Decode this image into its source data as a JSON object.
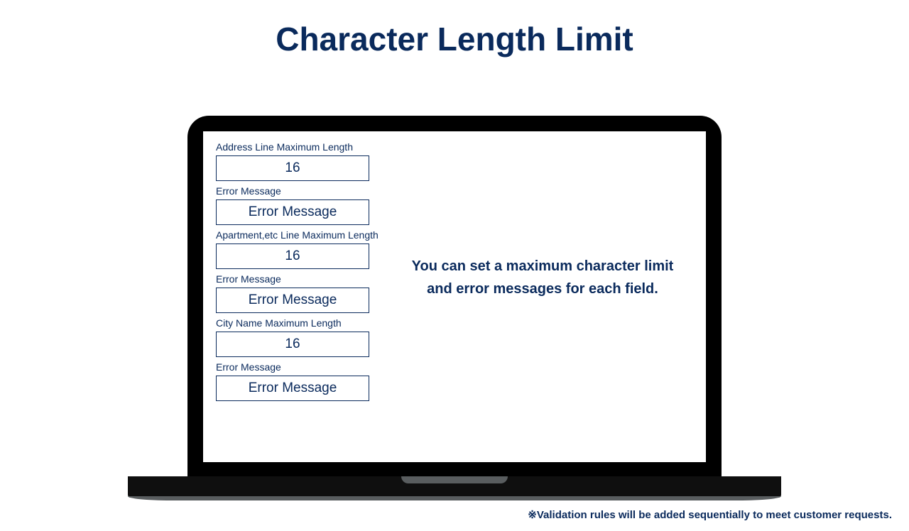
{
  "title": "Character Length Limit",
  "form": {
    "address": {
      "label": "Address Line Maximum Length",
      "value": "16",
      "error_label": "Error Message",
      "error_value": "Error Message"
    },
    "apartment": {
      "label": "Apartment,etc Line Maximum Length",
      "value": "16",
      "error_label": "Error Message",
      "error_value": "Error Message"
    },
    "city": {
      "label": "City Name Maximum Length",
      "value": "16",
      "error_label": "Error Message",
      "error_value": "Error Message"
    }
  },
  "description": {
    "line1": "You can set a maximum character limit",
    "line2": "and error messages for each field."
  },
  "footnote": "※Validation rules will be added sequentially to meet customer requests."
}
